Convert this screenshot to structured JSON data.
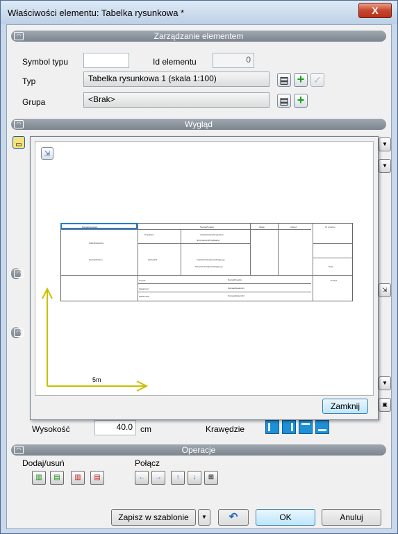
{
  "window": {
    "title": "Właściwości elementu: Tabelka rysunkowa *",
    "close_label": "X"
  },
  "sections": {
    "management": "Zarządzanie elementem",
    "appearance": "Wygląd",
    "operations": "Operacje"
  },
  "management": {
    "symbol_label": "Symbol typu",
    "symbol_value": "",
    "id_label": "Id elementu",
    "id_value": "0",
    "type_label": "Typ",
    "type_value": "Tabelka rysunkowa 1 (skala 1:100)",
    "group_label": "Grupa",
    "group_value": "<Brak>"
  },
  "preview": {
    "scale_label": "5m",
    "close_button": "Zamknij",
    "cells": {
      "r1": [
        "NazwaInwestora",
        "NazwaProjektu",
        "Skala",
        "Arkusz",
        "Nr rysunku"
      ],
      "r2": [
        "AdresInwestora",
        "Projektant",
        "ImięNazwiskoProjektanta",
        "NrUprawnieńProjektanta"
      ],
      "r3": [
        "NazwaObiektu",
        "Sprawdził",
        "ImięNazwiskoSprawdzającego",
        "NrUprawnieńSprawdzającego",
        "Data"
      ],
      "r4": [
        "Projekt",
        "Zawartość",
        "Zatwierdził",
        "NazwaProjektu",
        "NazwaZawartości",
        "NazwaZatwierdził",
        "Nr Rys"
      ]
    }
  },
  "dimensions": {
    "height_label": "Wysokość",
    "height_value": "40.0",
    "height_unit": "cm",
    "edges_label": "Krawędzie"
  },
  "operations": {
    "add_remove_label": "Dodaj/usuń",
    "merge_label": "Połącz"
  },
  "footer": {
    "save_template": "Zapisz w szablonie",
    "ok": "OK",
    "cancel": "Anuluj"
  }
}
